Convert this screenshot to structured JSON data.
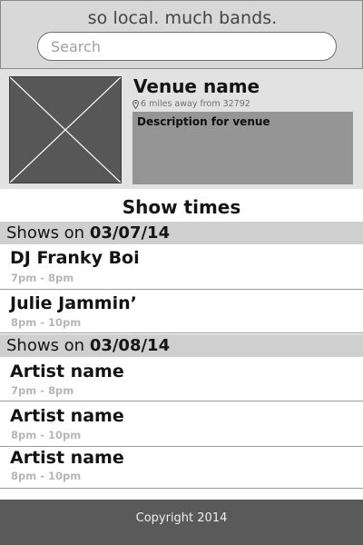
{
  "header": {
    "title": "so local. much bands.",
    "search_placeholder": "Search"
  },
  "venue": {
    "name": "Venue name",
    "distance": "6 miles away from 32792",
    "description": "Description for venue"
  },
  "shows_title": "Show times",
  "days": [
    {
      "prefix": "Shows on ",
      "date": "03/07/14",
      "shows": [
        {
          "artist": "DJ Franky Boi",
          "time": "7pm - 8pm"
        },
        {
          "artist": "Julie Jammin’",
          "time": "8pm - 10pm"
        }
      ]
    },
    {
      "prefix": "Shows on ",
      "date": "03/08/14",
      "shows": [
        {
          "artist": "Artist name",
          "time": "7pm - 8pm"
        },
        {
          "artist": "Artist name",
          "time": "8pm - 10pm"
        },
        {
          "artist": "Artist name",
          "time": "8pm - 10pm"
        }
      ]
    }
  ],
  "footer": {
    "copyright": "Copyright 2014"
  },
  "colors": {
    "header_bg": "#d8d8d8",
    "venue_bg": "#e2e2e2",
    "day_header_bg": "#cfcfcf",
    "description_bg": "#959595",
    "footer_bg": "#5a5a5b"
  }
}
